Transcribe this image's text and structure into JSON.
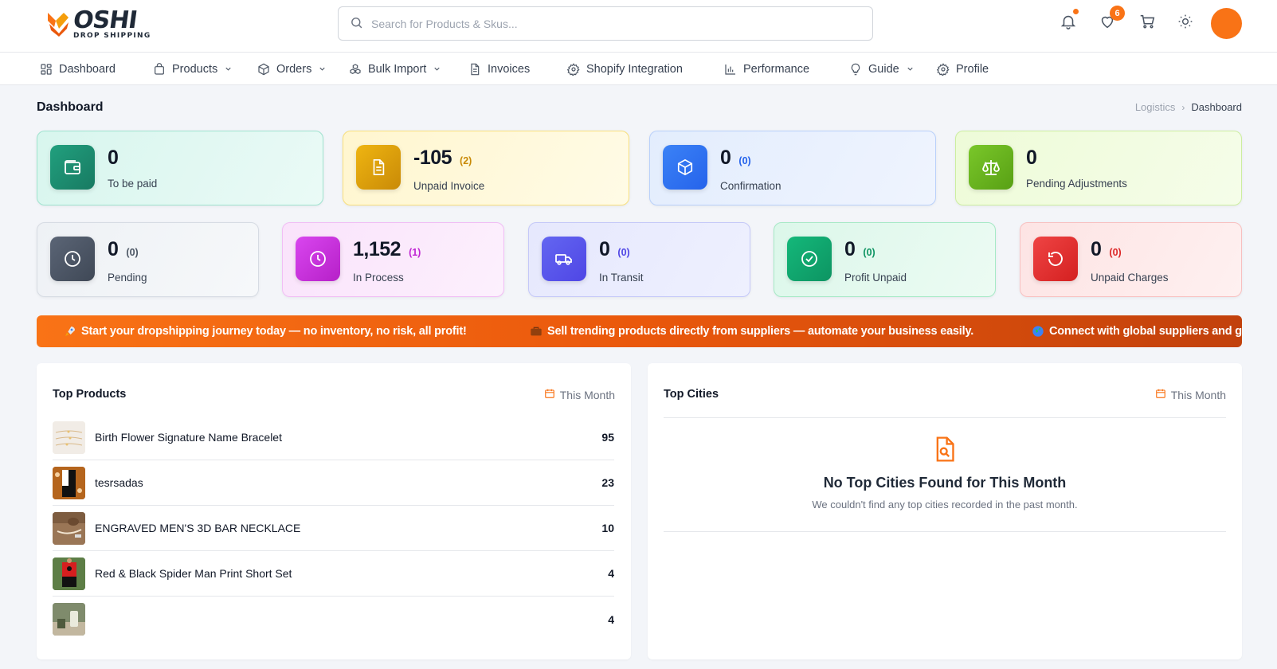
{
  "brand": {
    "name": "OSHI",
    "tagline": "DROP SHIPPING",
    "accent": "#f97316"
  },
  "search": {
    "placeholder": "Search for Products & Skus..."
  },
  "header": {
    "wishlist_count": "6",
    "icons": [
      "bell-icon",
      "heart-icon",
      "cart-icon",
      "sun-icon"
    ]
  },
  "nav": [
    {
      "label": "Dashboard",
      "icon": "grid-icon",
      "dropdown": false
    },
    {
      "label": "Products",
      "icon": "bag-icon",
      "dropdown": true
    },
    {
      "label": "Orders",
      "icon": "box-icon",
      "dropdown": true
    },
    {
      "label": "Bulk Import",
      "icon": "boxes-icon",
      "dropdown": true
    },
    {
      "label": "Invoices",
      "icon": "file-icon",
      "dropdown": false
    },
    {
      "label": "Shopify Integration",
      "icon": "gear-icon",
      "dropdown": false
    },
    {
      "label": "Performance",
      "icon": "bar-chart-icon",
      "dropdown": false
    },
    {
      "label": "Guide",
      "icon": "bulb-icon",
      "dropdown": true
    },
    {
      "label": "Profile",
      "icon": "gear-icon",
      "dropdown": false
    }
  ],
  "page": {
    "title": "Dashboard",
    "breadcrumb": [
      "Logistics",
      "Dashboard"
    ]
  },
  "stats_row1": [
    {
      "value": "0",
      "sub": "",
      "label": "To be paid",
      "icon": "wallet-icon",
      "color": "#1a8a6e"
    },
    {
      "value": "-105",
      "sub": "(2)",
      "label": "Unpaid Invoice",
      "icon": "invoice-icon",
      "color": "#d99a0b"
    },
    {
      "value": "0",
      "sub": "(0)",
      "label": "Confirmation",
      "icon": "package-icon",
      "color": "#2f6fec"
    },
    {
      "value": "0",
      "sub": "",
      "label": "Pending Adjustments",
      "icon": "scale-icon",
      "color": "#6cb51c"
    }
  ],
  "stats_row2": [
    {
      "value": "0",
      "sub": "(0)",
      "label": "Pending",
      "icon": "clock-icon",
      "color": "#4b5563"
    },
    {
      "value": "1,152",
      "sub": "(1)",
      "label": "In Process",
      "icon": "clock-icon",
      "color": "#c026d3"
    },
    {
      "value": "0",
      "sub": "(0)",
      "label": "In Transit",
      "icon": "truck-icon",
      "color": "#5b5ce6"
    },
    {
      "value": "0",
      "sub": "(0)",
      "label": "Profit Unpaid",
      "icon": "check-circle-icon",
      "color": "#10a16a"
    },
    {
      "value": "0",
      "sub": "(0)",
      "label": "Unpaid Charges",
      "icon": "refresh-icon",
      "color": "#e02a2a"
    }
  ],
  "ticker": [
    {
      "icon": "rocket-icon",
      "text": "Start your dropshipping journey today — no inventory, no risk, all profit!"
    },
    {
      "icon": "briefcase-icon",
      "text": "Sell trending products directly from suppliers — automate your business easily."
    },
    {
      "icon": "globe-icon",
      "text": "Connect with global suppliers and gro"
    }
  ],
  "top_products": {
    "title": "Top Products",
    "filter": "This Month",
    "items": [
      {
        "name": "Birth Flower Signature Name Bracelet",
        "count": "95"
      },
      {
        "name": "tesrsadas",
        "count": "23"
      },
      {
        "name": "ENGRAVED MEN'S 3D BAR NECKLACE",
        "count": "10"
      },
      {
        "name": "Red & Black Spider Man Print Short Set",
        "count": "4"
      },
      {
        "name": "",
        "count": "4"
      }
    ]
  },
  "top_cities": {
    "title": "Top Cities",
    "filter": "This Month",
    "empty_title": "No Top Cities Found for This Month",
    "empty_text": "We couldn't find any top cities recorded in the past month."
  }
}
